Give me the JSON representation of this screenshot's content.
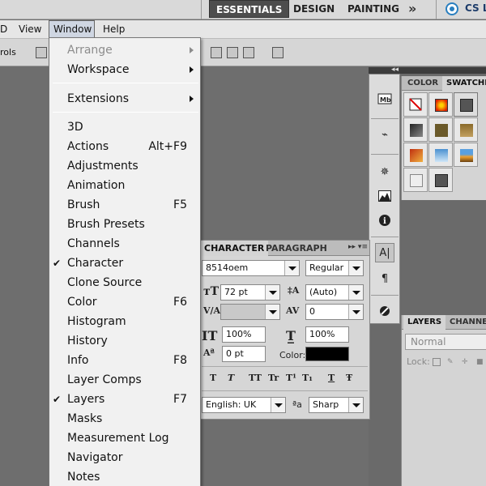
{
  "app": {
    "workspaces": [
      "ESSENTIALS",
      "DESIGN",
      "PAINTING"
    ],
    "workspace_more": "»",
    "cs_live": "CS Li"
  },
  "menubar": {
    "items": [
      "D",
      "View",
      "Window",
      "Help"
    ]
  },
  "options_bar": {
    "label": "rols"
  },
  "window_menu": {
    "items": [
      {
        "label": "Arrange",
        "submenu": true,
        "disabled": true
      },
      {
        "label": "Workspace",
        "submenu": true
      },
      {
        "label": "Extensions",
        "submenu": true
      },
      {
        "label": "3D"
      },
      {
        "label": "Actions",
        "shortcut": "Alt+F9"
      },
      {
        "label": "Adjustments"
      },
      {
        "label": "Animation"
      },
      {
        "label": "Brush",
        "shortcut": "F5"
      },
      {
        "label": "Brush Presets"
      },
      {
        "label": "Channels"
      },
      {
        "label": "Character",
        "checked": true
      },
      {
        "label": "Clone Source"
      },
      {
        "label": "Color",
        "shortcut": "F6"
      },
      {
        "label": "Histogram"
      },
      {
        "label": "History"
      },
      {
        "label": "Info",
        "shortcut": "F8"
      },
      {
        "label": "Layer Comps"
      },
      {
        "label": "Layers",
        "shortcut": "F7",
        "checked": true
      },
      {
        "label": "Masks"
      },
      {
        "label": "Measurement Log"
      },
      {
        "label": "Navigator"
      },
      {
        "label": "Notes"
      }
    ],
    "check_mark": "✔"
  },
  "swatches_panel": {
    "tabs": [
      "COLOR",
      "SWATCHE"
    ]
  },
  "layers_panel": {
    "tabs": [
      "LAYERS",
      "CHANNE"
    ],
    "blend_mode": "Normal",
    "lock_label": "Lock:"
  },
  "character_panel": {
    "tabs": [
      "CHARACTER",
      "PARAGRAPH"
    ],
    "font_family": "8514oem",
    "font_style": "Regular",
    "font_size": "72 pt",
    "leading": "(Auto)",
    "kerning": "",
    "tracking": "0",
    "vertical_scale": "100%",
    "horizontal_scale": "100%",
    "baseline_shift": "0 pt",
    "color_label": "Color:",
    "text_color": "#000000",
    "language": "English: UK",
    "antialias_icon_label": "ªa",
    "antialias": "Sharp",
    "style_buttons": [
      "T",
      "T",
      "TT",
      "Tr",
      "T¹",
      "T₁",
      "T",
      "Ŧ"
    ]
  }
}
